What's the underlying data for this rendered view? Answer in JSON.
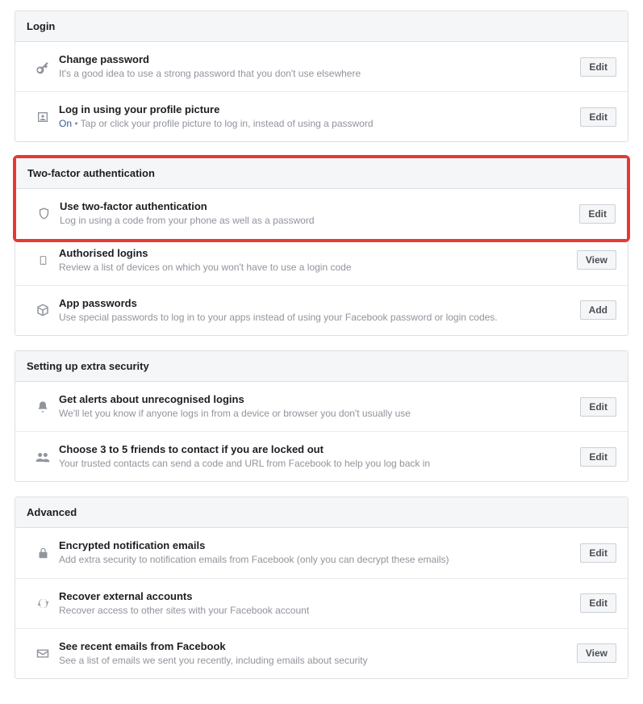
{
  "sections": {
    "login": {
      "header": "Login",
      "rows": {
        "change_password": {
          "title": "Change password",
          "desc": "It's a good idea to use a strong password that you don't use elsewhere",
          "btn": "Edit"
        },
        "profile_picture": {
          "title": "Log in using your profile picture",
          "status": "On",
          "desc": " • Tap or click your profile picture to log in, instead of using a password",
          "btn": "Edit"
        }
      }
    },
    "tfa": {
      "header": "Two-factor authentication",
      "rows": {
        "use_tfa": {
          "title": "Use two-factor authentication",
          "desc": "Log in using a code from your phone as well as a password",
          "btn": "Edit"
        },
        "authorised": {
          "title": "Authorised logins",
          "desc": "Review a list of devices on which you won't have to use a login code",
          "btn": "View"
        },
        "app_passwords": {
          "title": "App passwords",
          "desc": "Use special passwords to log in to your apps instead of using your Facebook password or login codes.",
          "btn": "Add"
        }
      }
    },
    "extra": {
      "header": "Setting up extra security",
      "rows": {
        "alerts": {
          "title": "Get alerts about unrecognised logins",
          "desc": "We'll let you know if anyone logs in from a device or browser you don't usually use",
          "btn": "Edit"
        },
        "friends": {
          "title": "Choose 3 to 5 friends to contact if you are locked out",
          "desc": "Your trusted contacts can send a code and URL from Facebook to help you log back in",
          "btn": "Edit"
        }
      }
    },
    "advanced": {
      "header": "Advanced",
      "rows": {
        "encrypted": {
          "title": "Encrypted notification emails",
          "desc": "Add extra security to notification emails from Facebook (only you can decrypt these emails)",
          "btn": "Edit"
        },
        "recover": {
          "title": "Recover external accounts",
          "desc": "Recover access to other sites with your Facebook account",
          "btn": "Edit"
        },
        "emails": {
          "title": "See recent emails from Facebook",
          "desc": "See a list of emails we sent you recently, including emails about security",
          "btn": "View"
        }
      }
    }
  }
}
